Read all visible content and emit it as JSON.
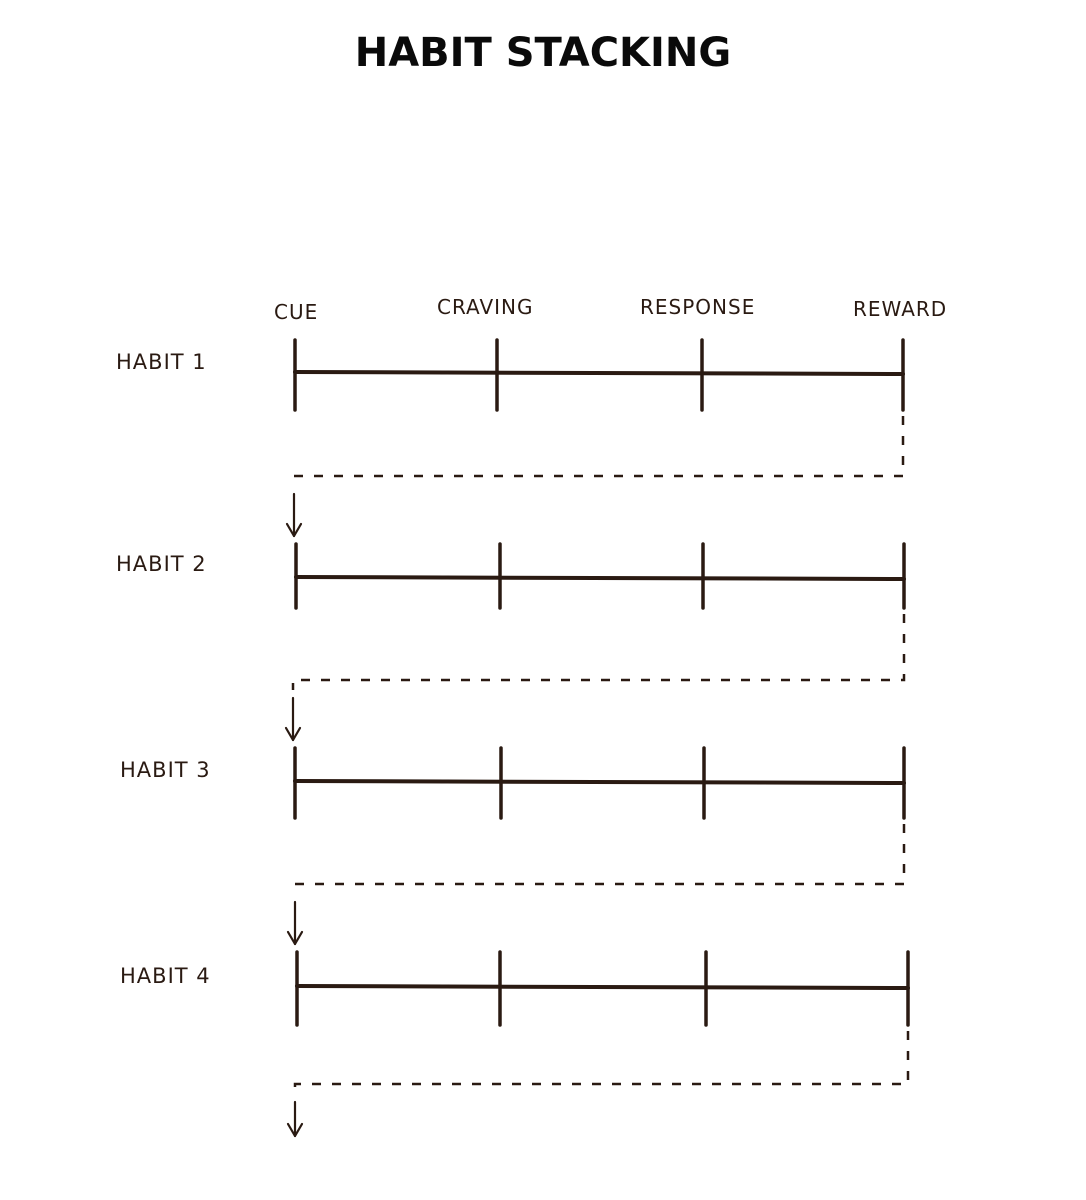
{
  "title": "HABIT STACKING",
  "ink_color": "#2a1a12",
  "stages": [
    "CUE",
    "CRAVING",
    "RESPONSE",
    "REWARD"
  ],
  "habits": [
    {
      "label": "HABIT 1"
    },
    {
      "label": "HABIT 2"
    },
    {
      "label": "HABIT 3"
    },
    {
      "label": "HABIT 4"
    }
  ],
  "flow": "Reward of each habit connects via dashed line to the Cue of the next habit; final habit's reward flows to a new cue (arrow continues downward)"
}
